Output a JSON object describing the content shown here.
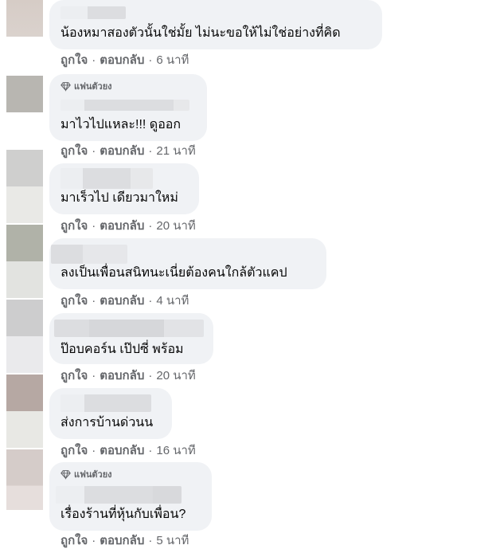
{
  "comments": [
    {
      "badge": "",
      "text": "น้องหมาสองตัวนั้นใช่มั้ย ไม่นะขอให้ไม่ใช่อย่างที่คิด",
      "like": "ถูกใจ",
      "reply": "ตอบกลับ",
      "time": "6 นาที"
    },
    {
      "badge": "แฟนตัวยง",
      "text": "มาไวไปแหละ!!! ดูออก",
      "like": "ถูกใจ",
      "reply": "ตอบกลับ",
      "time": "21 นาที"
    },
    {
      "badge": "",
      "text": "มาเร็วไป เดียวมาใหม่",
      "like": "ถูกใจ",
      "reply": "ตอบกลับ",
      "time": "20 นาที"
    },
    {
      "badge": "",
      "text": "ลงเป็นเพื่อนสนิทนะเนี่ยต้องคนใกล้ตัวแคป",
      "like": "ถูกใจ",
      "reply": "ตอบกลับ",
      "time": "4 นาที"
    },
    {
      "badge": "",
      "text": "ป๊อบคอร์น เป๊ปซี่ พร้อม",
      "like": "ถูกใจ",
      "reply": "ตอบกลับ",
      "time": "20 นาที"
    },
    {
      "badge": "",
      "text": "ส่งการบ้านด่วนน",
      "like": "ถูกใจ",
      "reply": "ตอบกลับ",
      "time": "16 นาที"
    },
    {
      "badge": "แฟนตัวยง",
      "text": "เรื่องร้านที่หุ้นกับเพื่อน?",
      "like": "ถูกใจ",
      "reply": "ตอบกลับ",
      "time": "5 นาที"
    }
  ],
  "separator": "·",
  "colors": {
    "bubble": "#f0f2f5",
    "meta": "#65676b",
    "text": "#050505"
  }
}
